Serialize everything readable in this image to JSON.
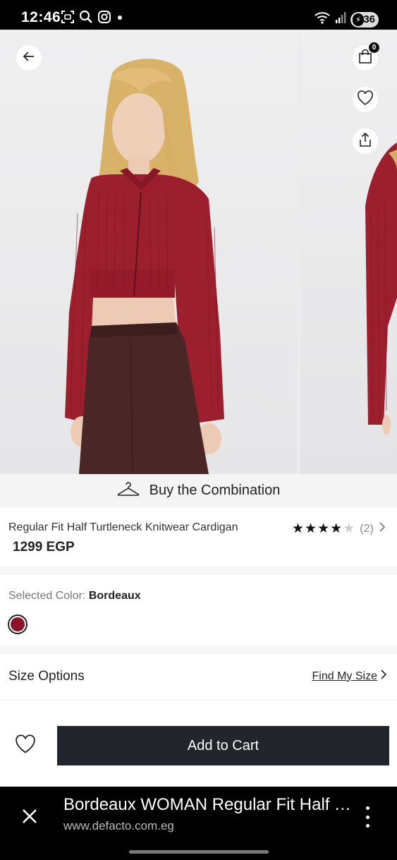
{
  "status_bar": {
    "time": "12:46",
    "battery": "36",
    "icons": [
      "screenshot-icon",
      "search-icon",
      "instagram-icon",
      "dot-icon",
      "wifi-icon",
      "signal-icon",
      "battery-charging-icon"
    ]
  },
  "gallery": {
    "cart_count": "0"
  },
  "combination": {
    "label": "Buy the Combination"
  },
  "product": {
    "title": "Regular Fit Half Turtleneck Knitwear Cardigan",
    "price": "1299 EGP",
    "rating_stars": 4,
    "rating_max": 5,
    "rating_count": "(2)"
  },
  "color": {
    "label": "Selected Color:",
    "value": "Bordeaux",
    "swatch_hex": "#8a1427"
  },
  "size": {
    "title": "Size Options",
    "find_my_size": "Find My Size"
  },
  "cart_bar": {
    "add_to_cart": "Add to Cart"
  },
  "browser": {
    "page_title": "Bordeaux WOMAN Regular Fit Half Turtleneck Knitwear Cardigan",
    "url": "www.defacto.com.eg"
  },
  "colors": {
    "accent_dark": "#22252b",
    "star": "#111111",
    "star_empty": "#cfcfcf",
    "garment": "#9c1f2e",
    "skirt": "#4a2626"
  }
}
